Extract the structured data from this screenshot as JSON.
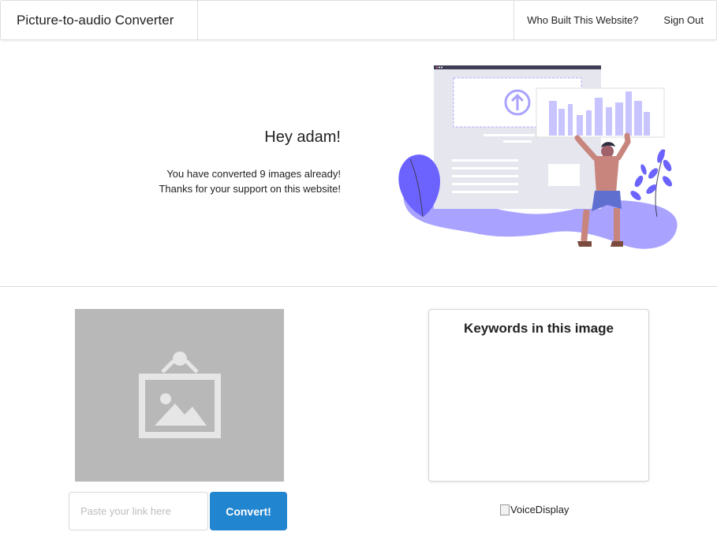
{
  "header": {
    "brand": "Picture-to-audio Converter",
    "nav": [
      {
        "label": "Who Built This Website?"
      },
      {
        "label": "Sign Out"
      }
    ]
  },
  "hero": {
    "greeting": "Hey adam!",
    "converted_line": "You have converted 9 images already!",
    "thanks_line": "Thanks for your support on this website!"
  },
  "converter": {
    "preview_icon": "image-placeholder-icon",
    "link_placeholder": "Paste your link here",
    "link_value": "",
    "convert_label": "Convert!"
  },
  "keywords": {
    "title": "Keywords in this image",
    "items": []
  },
  "voice": {
    "alt_text": "VoiceDisplay"
  },
  "colors": {
    "primary_button": "#2185d0",
    "illustration_accent": "#6c63ff",
    "preview_bg": "#b8b8b8"
  }
}
